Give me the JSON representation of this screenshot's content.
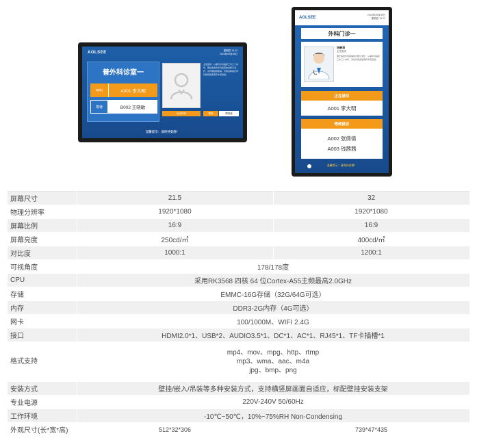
{
  "landscape_screen": {
    "logo": "AOLSEE",
    "time_line1": "星期四 13:12",
    "time_line2": "2024年09月05日",
    "room_title": "普外科诊室一",
    "calling_label": "呼叫",
    "calling_value": "A001 李大明",
    "waiting_label": "等待",
    "waiting_value": "B002 王晓敏",
    "bio": "主任医师，从事普外科临床工作三十余年，擅长各类普外科疾病的诊断与治疗，对肝胆胰脾疾病、胃肠道肿瘤及甲状腺乳腺疾病有丰富经验。",
    "btn_schedule": "出诊时间",
    "btn_pause": "暂停",
    "btn_weekly": "周排班",
    "notice": "温馨提示：请保持安静！"
  },
  "portrait_screen": {
    "logo": "AOLSEE",
    "time_line1": "2024年09月05日",
    "time_line2": "星期四 13:12",
    "room_title": "外科门诊一",
    "doctor_name": "张静涛",
    "doctor_title": "主任医师",
    "bio": "擅长各类外科疾病的诊断与治疗，从事外科临床工作三十余年，对常见病多发病有丰富经验。",
    "current_label": "正在就诊",
    "current_value": "A001 李大明",
    "waiting_label": "等候就诊",
    "waiting_values": [
      "A002 张倩倩",
      "A003 钱茜茜"
    ],
    "notice": "温馨提示：请保持安静！"
  },
  "specs": {
    "rows": [
      {
        "label": "屏幕尺寸",
        "v1": "21.5",
        "v2": "32"
      },
      {
        "label": "物理分辨率",
        "v1": "1920*1080",
        "v2": "1920*1080"
      },
      {
        "label": "屏幕比例",
        "v1": "16:9",
        "v2": "16:9"
      },
      {
        "label": "屏幕亮度",
        "v1": "250cd/㎡",
        "v2": "400cd/㎡"
      },
      {
        "label": "对比度",
        "v1": "1000:1",
        "v2": "1200:1"
      },
      {
        "label": "可视角度",
        "span": "178/178度"
      },
      {
        "label": "CPU",
        "span": "采用RK3568 四核 64 位Cortex-A55主频最高2.0GHz"
      },
      {
        "label": "存储",
        "span": "EMMC-16G存储（32G/64G可选）"
      },
      {
        "label": "内存",
        "span": "DDR3-2G内存（4G可选）"
      },
      {
        "label": "网卡",
        "span": "100/1000M、WIFI 2.4G"
      },
      {
        "label": "接口",
        "span": "HDMI2.0*1、USB*2、AUDIO3.5*1、DC*1、AC*1、RJ45*1、TF卡插槽*1"
      },
      {
        "label": "格式支持",
        "span_lines": [
          "mp4、mov、mpg、http、rtmp",
          "mp3、wma、aac、m4a",
          "jpg、bmp、png"
        ]
      },
      {
        "label": "安装方式",
        "span": "壁挂/嵌入/吊装等多种安装方式，支持横竖屏画面自适应，标配壁挂安装支架"
      },
      {
        "label": "专业电源",
        "span": "220V-240V 50/60Hz"
      },
      {
        "label": "工作环境",
        "span": "-10℃~50℃，10%~75%RH Non-Condensing"
      },
      {
        "label": "外观尺寸(长*宽*高)",
        "v1": "512*32*306",
        "v2": "739*47*435"
      }
    ]
  }
}
